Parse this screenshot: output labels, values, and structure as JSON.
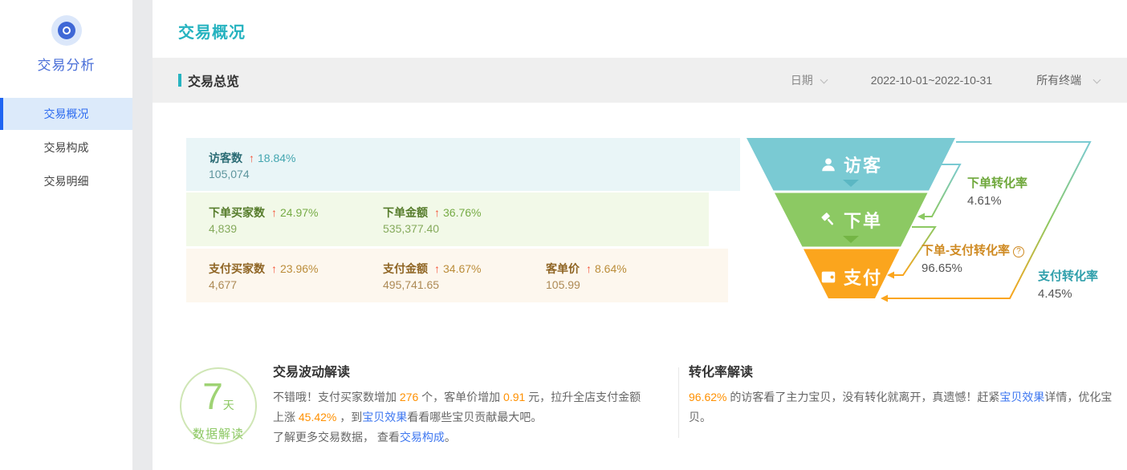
{
  "colors": {
    "accent_teal": "#26b3c0",
    "sidebar_active_blue": "#2e6cf0",
    "funnel_teal": "#7acad3",
    "funnel_green": "#8cc963",
    "funnel_orange": "#fba51d",
    "trend_up_red": "#f4553a",
    "highlight_orange": "#ff9000",
    "link_blue": "#3e77f0"
  },
  "icons": {
    "up_arrow": "↑",
    "help": "?"
  },
  "sidebar": {
    "title": "交易分析",
    "items": [
      {
        "label": "交易概况",
        "active": true
      },
      {
        "label": "交易构成",
        "active": false
      },
      {
        "label": "交易明细",
        "active": false
      }
    ]
  },
  "header": {
    "title": "交易概况"
  },
  "filter_band": {
    "section_title": "交易总览",
    "date_label": "日期",
    "date_range": "2022-10-01~2022-10-31",
    "terminal": "所有终端"
  },
  "overview": {
    "cards": [
      {
        "metrics": [
          {
            "label": "访客数",
            "pct": "18.84%",
            "value": "105,074"
          }
        ]
      },
      {
        "metrics": [
          {
            "label": "下单买家数",
            "pct": "24.97%",
            "value": "4,839"
          },
          {
            "label": "下单金额",
            "pct": "36.76%",
            "value": "535,377.40"
          }
        ]
      },
      {
        "metrics": [
          {
            "label": "支付买家数",
            "pct": "23.96%",
            "value": "4,677"
          },
          {
            "label": "支付金额",
            "pct": "34.67%",
            "value": "495,741.65"
          },
          {
            "label": "客单价",
            "pct": "8.64%",
            "value": "105.99"
          }
        ]
      }
    ]
  },
  "funnel": {
    "stages": [
      {
        "label": "访客"
      },
      {
        "label": "下单"
      },
      {
        "label": "支付"
      }
    ],
    "rates": [
      {
        "label": "下单转化率",
        "value": "4.61%"
      },
      {
        "label": "下单-支付转化率",
        "value": "96.65%"
      },
      {
        "label": "支付转化率",
        "value": "4.45%"
      }
    ]
  },
  "insights": {
    "badge": {
      "number": "7",
      "unit": "天",
      "caption": "数据解读"
    },
    "trade": {
      "title": "交易波动解读",
      "p1": [
        "不错哦！支付买家数增加 ",
        "276",
        " 个，客单价增加 ",
        "0.91",
        " 元，拉升全店支付金额上涨 ",
        "45.42%",
        " ，到",
        "宝贝效果",
        "看看哪些宝贝贡献最大吧。"
      ],
      "p2": [
        "了解更多交易数据， 查看",
        "交易构成",
        "。"
      ]
    },
    "conversion": {
      "title": "转化率解读",
      "p1": [
        "96.62%",
        " 的访客看了主力宝贝，没有转化就离开，真遗憾！赶紧",
        "宝贝效果",
        "详情，优化宝贝。"
      ]
    }
  }
}
